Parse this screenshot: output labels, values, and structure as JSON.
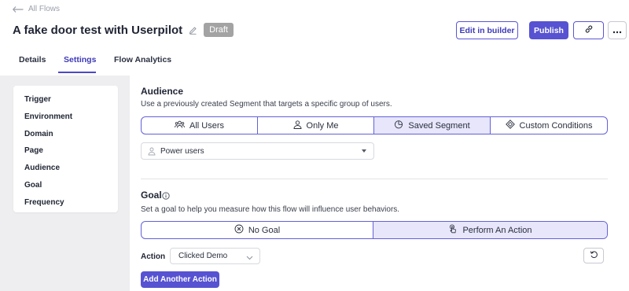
{
  "header": {
    "back_label": "All Flows",
    "title": "A fake door test with Userpilot",
    "status_badge": "Draft",
    "edit_button": "Edit in builder",
    "publish_button": "Publish"
  },
  "tabs": [
    {
      "label": "Details",
      "active": false
    },
    {
      "label": "Settings",
      "active": true
    },
    {
      "label": "Flow Analytics",
      "active": false
    }
  ],
  "sidebar": {
    "items": [
      {
        "label": "Trigger"
      },
      {
        "label": "Environment"
      },
      {
        "label": "Domain"
      },
      {
        "label": "Page"
      },
      {
        "label": "Audience"
      },
      {
        "label": "Goal"
      },
      {
        "label": "Frequency"
      }
    ]
  },
  "audience": {
    "title": "Audience",
    "description": "Use a previously created Segment that targets a specific group of users.",
    "options": [
      {
        "label": "All Users",
        "icon": "users-icon",
        "selected": false
      },
      {
        "label": "Only Me",
        "icon": "user-icon",
        "selected": false
      },
      {
        "label": "Saved Segment",
        "icon": "pie-chart-icon",
        "selected": true
      },
      {
        "label": "Custom Conditions",
        "icon": "diamond-icon",
        "selected": false
      }
    ],
    "segment_select_value": "Power users"
  },
  "goal": {
    "title": "Goal",
    "description": "Set a goal to help you measure how this flow will influence user behaviors.",
    "options": [
      {
        "label": "No Goal",
        "icon": "x-circle-icon",
        "selected": false
      },
      {
        "label": "Perform An Action",
        "icon": "pointer-icon",
        "selected": true
      }
    ],
    "action_label": "Action",
    "action_value": "Clicked Demo",
    "add_action_button": "Add Another Action"
  },
  "colors": {
    "accent": "#5652d2",
    "selected_bg": "#e7e6fb",
    "content_bg": "#eeeef0",
    "draft_badge": "#a3a3a3"
  }
}
